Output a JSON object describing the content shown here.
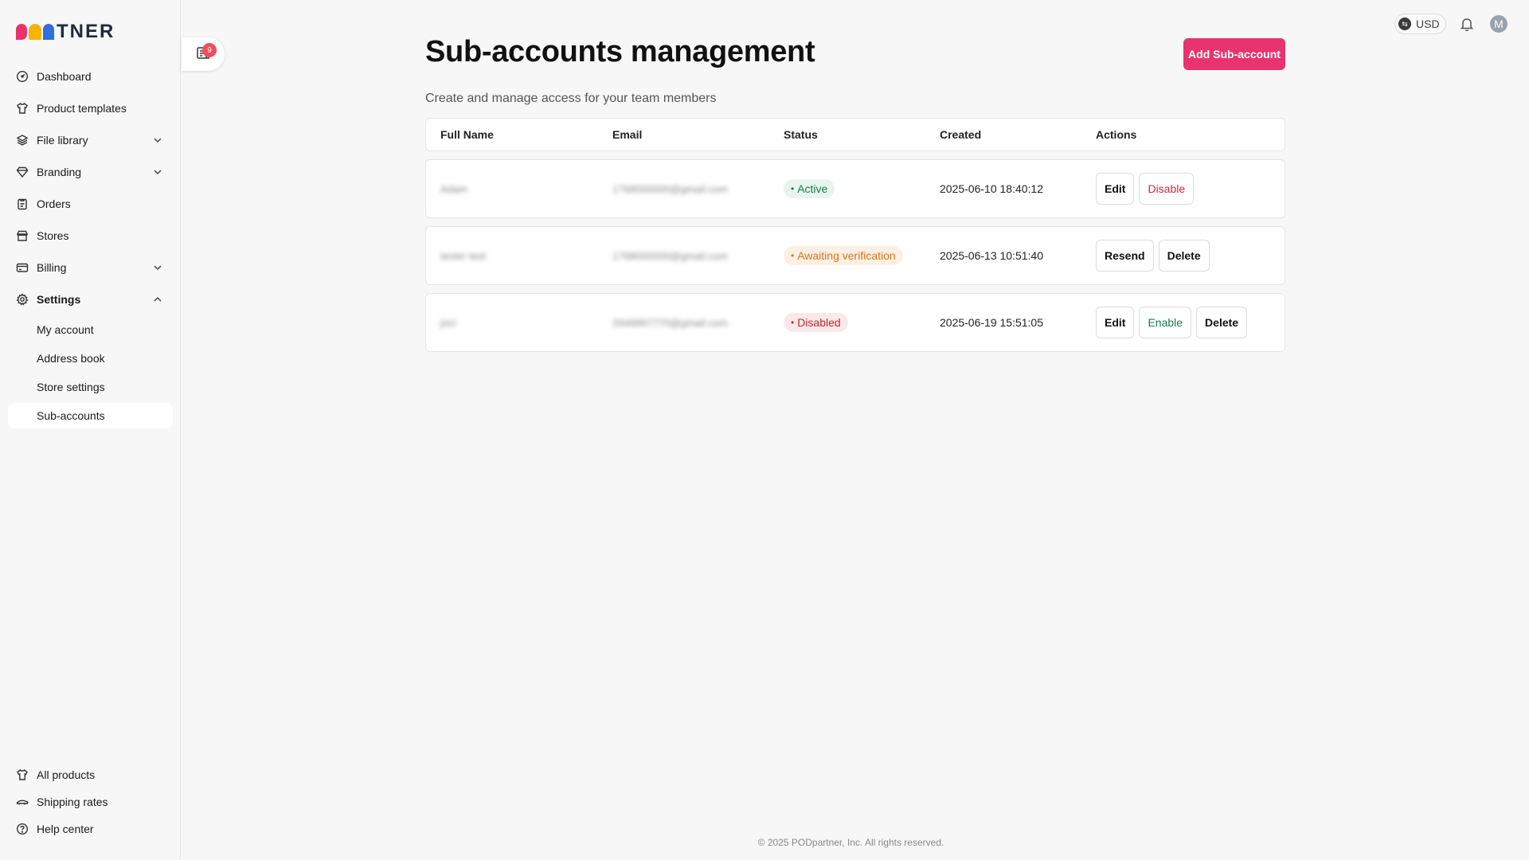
{
  "brand": {
    "logo_text": "TNER"
  },
  "sidebar": {
    "items": [
      {
        "label": "Dashboard",
        "icon": "dashboard-icon"
      },
      {
        "label": "Product templates",
        "icon": "shirt-icon"
      },
      {
        "label": "File library",
        "icon": "layers-icon"
      },
      {
        "label": "Branding",
        "icon": "diamond-icon"
      },
      {
        "label": "Orders",
        "icon": "clipboard-icon"
      },
      {
        "label": "Stores",
        "icon": "store-icon"
      },
      {
        "label": "Billing",
        "icon": "card-icon"
      },
      {
        "label": "Settings",
        "icon": "gear-icon"
      }
    ],
    "settings_sub": [
      {
        "label": "My account"
      },
      {
        "label": "Address book"
      },
      {
        "label": "Store settings"
      },
      {
        "label": "Sub-accounts"
      }
    ],
    "bottom": [
      {
        "label": "All products",
        "icon": "box-icon"
      },
      {
        "label": "Shipping rates",
        "icon": "truck-icon"
      },
      {
        "label": "Help center",
        "icon": "help-icon"
      }
    ]
  },
  "notifications": {
    "count": "9"
  },
  "header": {
    "currency": "USD",
    "avatar_initial": "M"
  },
  "main": {
    "title": "Sub-accounts management",
    "subtitle": "Create and manage access for your team members",
    "add_button": "Add Sub-account",
    "columns": [
      "Full Name",
      "Email",
      "Status",
      "Created",
      "Actions"
    ],
    "rows": [
      {
        "name": "Adam",
        "email": "1768000000@gmail.com",
        "status": "Active",
        "created": "2025-06-10 18:40:12",
        "actions": [
          "Edit",
          "Disable"
        ]
      },
      {
        "name": "tester test",
        "email": "1768000000@gmail.com",
        "status": "Awaiting verification",
        "created": "2025-06-13 10:51:40",
        "actions": [
          "Resend",
          "Delete"
        ]
      },
      {
        "name": "joci",
        "email": "3346897770@gmail.com",
        "status": "Disabled",
        "created": "2025-06-19 15:51:05",
        "actions": [
          "Edit",
          "Enable",
          "Delete"
        ]
      }
    ]
  },
  "footer": {
    "text": "© 2025 PODpartner, Inc. All rights reserved."
  }
}
